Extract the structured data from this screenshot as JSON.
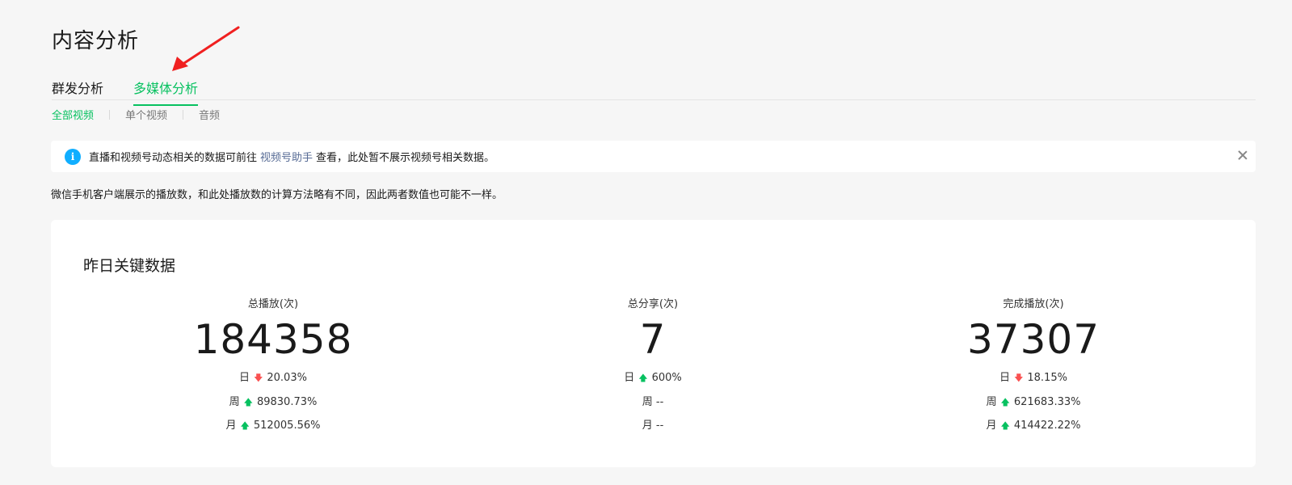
{
  "page_title": "内容分析",
  "tabs": [
    {
      "label": "群发分析",
      "active": false
    },
    {
      "label": "多媒体分析",
      "active": true
    }
  ],
  "subtabs": [
    {
      "label": "全部视频",
      "active": true
    },
    {
      "label": "单个视频",
      "active": false
    },
    {
      "label": "音频",
      "active": false
    }
  ],
  "notice": {
    "icon": "info-icon",
    "text_before": "直播和视频号动态相关的数据可前往",
    "link": "视频号助手",
    "text_after": "查看，此处暂不展示视频号相关数据。"
  },
  "hint": "微信手机客户端展示的播放数，和此处播放数的计算方法略有不同，因此两者数值也可能不一样。",
  "key_data": {
    "title": "昨日关键数据",
    "metrics": [
      {
        "label": "总播放(次)",
        "value": "184358",
        "trends": [
          {
            "period": "日",
            "direction": "down",
            "value": "20.03%"
          },
          {
            "period": "周",
            "direction": "up",
            "value": "89830.73%"
          },
          {
            "period": "月",
            "direction": "up",
            "value": "512005.56%"
          }
        ]
      },
      {
        "label": "总分享(次)",
        "value": "7",
        "trends": [
          {
            "period": "日",
            "direction": "up",
            "value": "600%"
          },
          {
            "period": "周",
            "direction": "none",
            "value": "--"
          },
          {
            "period": "月",
            "direction": "none",
            "value": "--"
          }
        ]
      },
      {
        "label": "完成播放(次)",
        "value": "37307",
        "trends": [
          {
            "period": "日",
            "direction": "down",
            "value": "18.15%"
          },
          {
            "period": "周",
            "direction": "up",
            "value": "621683.33%"
          },
          {
            "period": "月",
            "direction": "up",
            "value": "414422.22%"
          }
        ]
      }
    ]
  },
  "colors": {
    "accent": "#07c160",
    "link": "#576b95",
    "info": "#10aeff",
    "down": "#fa5151",
    "annotation": "#f02020"
  }
}
